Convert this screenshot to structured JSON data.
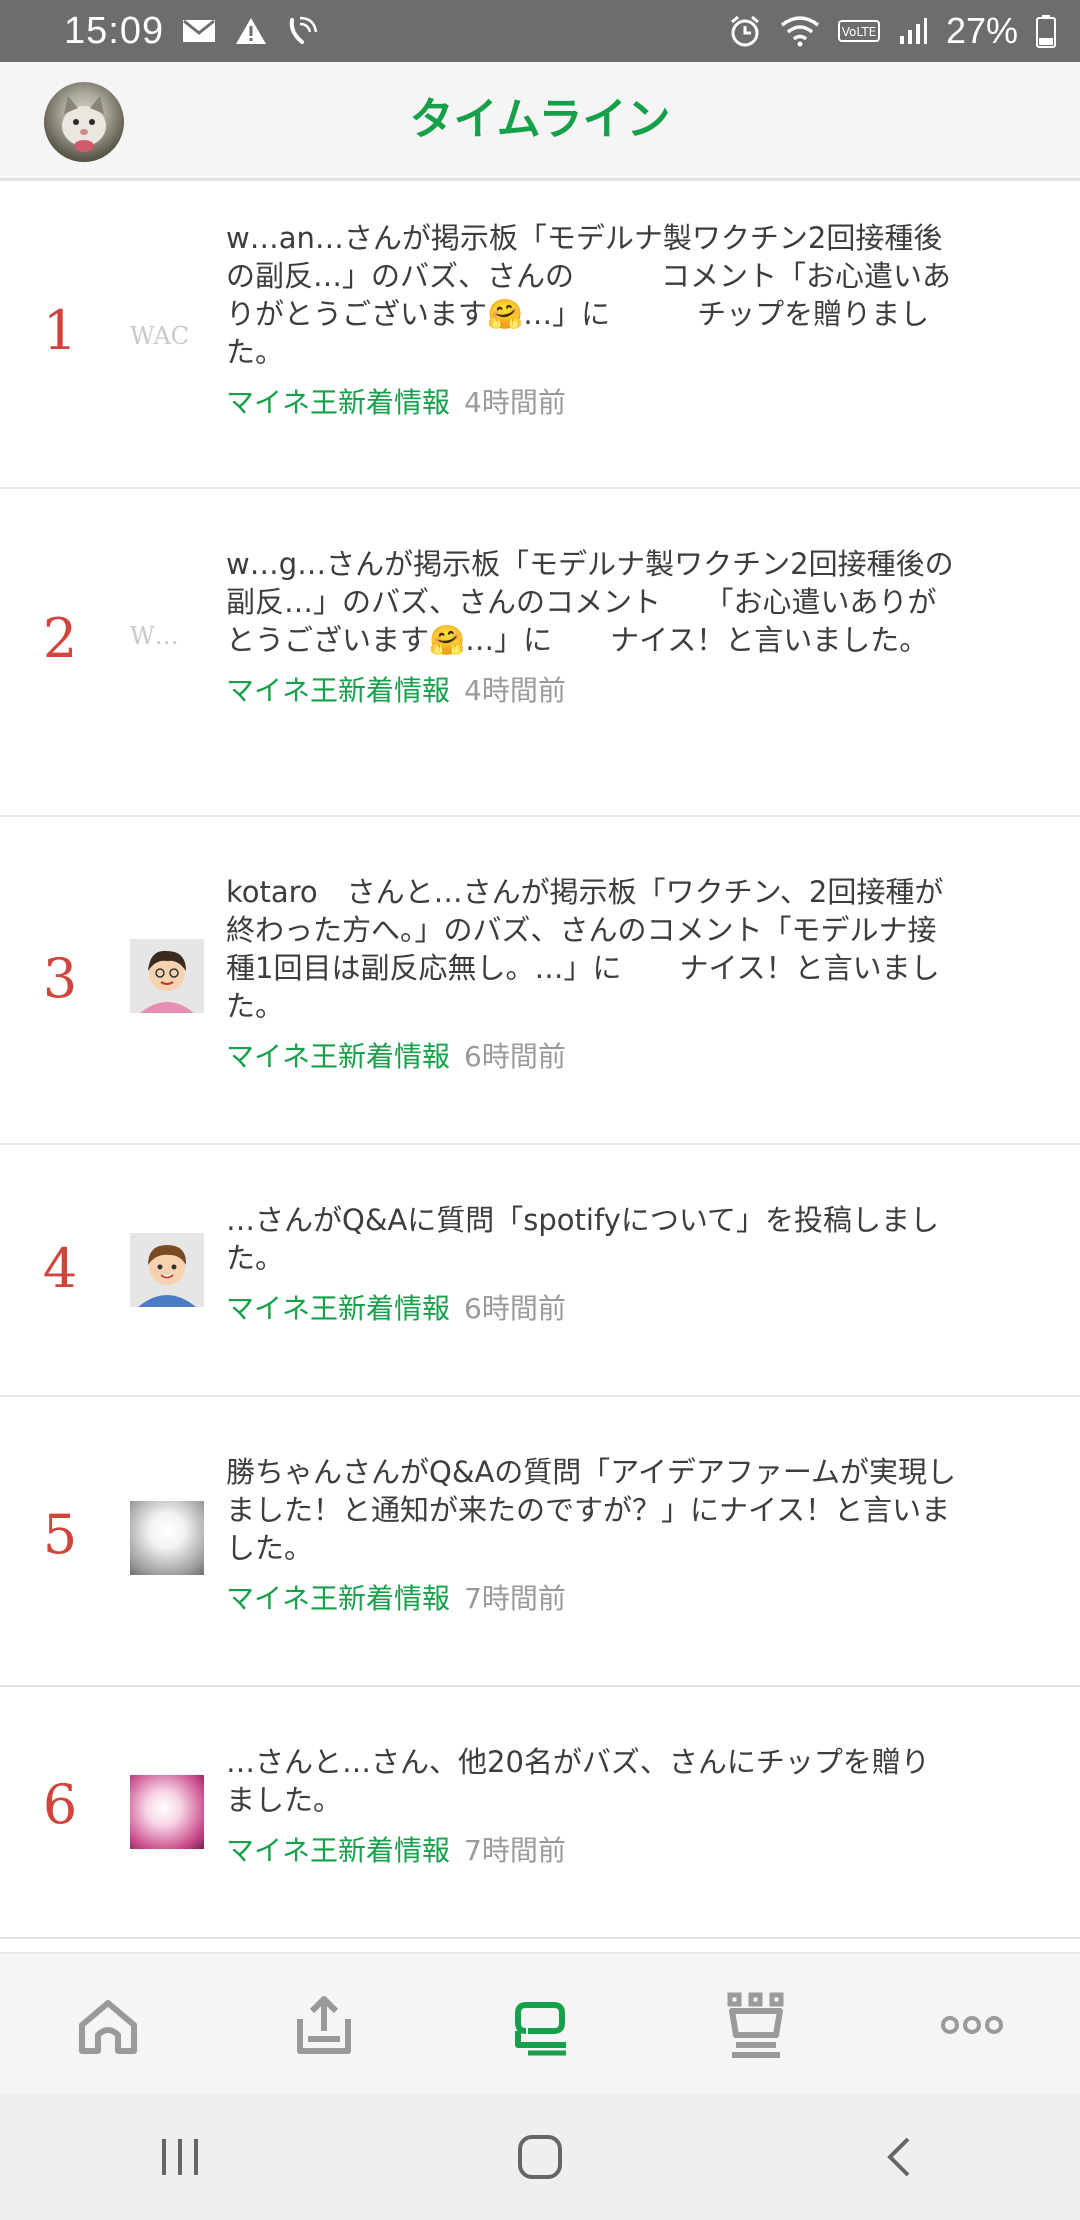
{
  "status_bar": {
    "time": "15:09",
    "battery": "27%",
    "left_icons": [
      "mail-icon",
      "warning-icon",
      "vowifi-call-icon"
    ],
    "right_icons": [
      "alarm-icon",
      "wifi-icon",
      "volte-icon",
      "signal-icon",
      "battery-icon"
    ]
  },
  "header": {
    "title": "タイムライン",
    "avatar": "user-avatar-cat"
  },
  "timeline": [
    {
      "number": "1",
      "avatar_text": "WAC",
      "text": "w…an…さんが掲示板「モデルナ製ワクチン2回接種後の副反…」のバズ、さんの　　　コメント「お心遣いありがとうございます🤗…」に　　　チップを贈りました。",
      "source": "マイネ王新着情報",
      "time": "4時間前"
    },
    {
      "number": "2",
      "avatar_text": "W…",
      "text": "w…g…さんが掲示板「モデルナ製ワクチン2回接種後の副反…」のバズ、さんのコメント　　「お心遣いありがとうございます🤗…」に　　ナイス！と言いました。",
      "source": "マイネ王新着情報",
      "time": "4時間前"
    },
    {
      "number": "3",
      "text": "kotaro　さんと…さんが掲示板「ワクチン、2回接種が終わった方へ。」のバズ、さんのコメント「モデルナ接種1回目は副反応無し。…」に　　ナイス！と言いました。",
      "source": "マイネ王新着情報",
      "time": "6時間前"
    },
    {
      "number": "4",
      "text": "…さんがQ&Aに質問「spotifyについて」を投稿しました。",
      "source": "マイネ王新着情報",
      "time": "6時間前"
    },
    {
      "number": "5",
      "text": "勝ちゃんさんがQ&Aの質問「アイデアファームが実現しました！と通知が来たのですが？」にナイス！と言いました。",
      "source": "マイネ王新着情報",
      "time": "7時間前"
    },
    {
      "number": "6",
      "text": "…さんと…さん、他20名がバズ、さんにチップを贈りました。",
      "source": "マイネ王新着情報",
      "time": "7時間前"
    }
  ],
  "tab_bar": {
    "tabs": [
      "home-icon",
      "upload-icon",
      "timeline-icon",
      "ranking-crown-icon",
      "more-icon"
    ],
    "active": "timeline-icon",
    "active_color": "#17a04a",
    "inactive_color": "#9a9a9a"
  },
  "system_nav": [
    "recents-icon",
    "home-circle-icon",
    "back-icon"
  ],
  "colors": {
    "accent": "#17a04a",
    "number": "#d0443c",
    "text": "#3d3d3d",
    "meta": "#9a9a9a"
  }
}
